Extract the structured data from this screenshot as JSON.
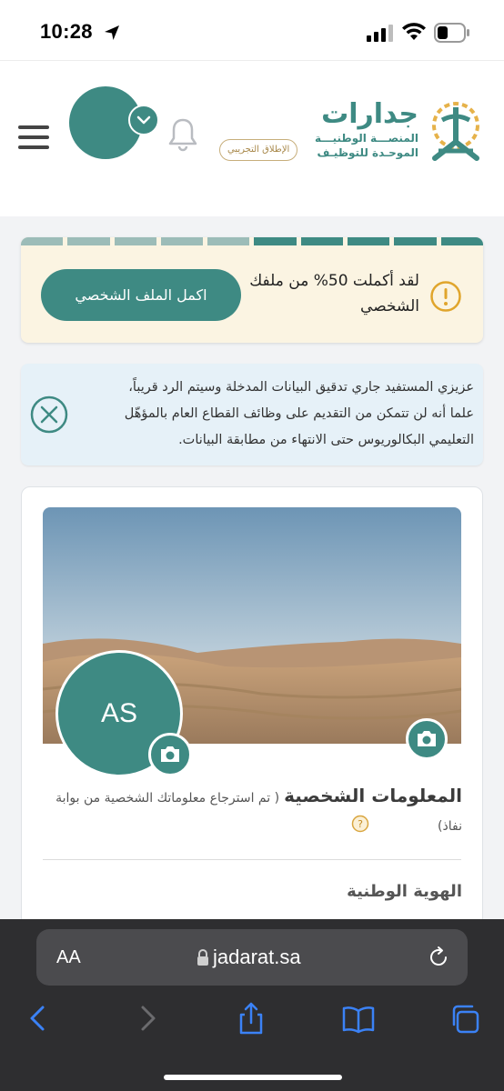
{
  "status_bar": {
    "time": "10:28"
  },
  "header": {
    "logo": {
      "name": "جدارات",
      "subtitle_line1": "المنصـــة الوطنيـــة",
      "subtitle_line2": "الموحـدة للتوظيـف"
    },
    "beta_badge": "الإطلاق التجريبي",
    "icons": {
      "menu": "hamburger-menu-icon",
      "notifications": "bell-icon",
      "account": "chevron-down-icon"
    },
    "accent_color": "#3e8a83"
  },
  "progress": {
    "message": "لقد أكملت 50% من ملفك الشخصي",
    "percent": 50,
    "segments_total": 10,
    "segments_filled": 5,
    "button_label": "اكمل الملف الشخصي",
    "warning_color": "#e0a52c"
  },
  "info_banner": {
    "message": "عزيزي المستفيد جاري تدقيق البيانات المدخلة وسيتم الرد قريباً، علما أنه لن تتمكن من التقديم على وظائف القطاع العام بالمؤهّل التعليمي البكالوريوس حتى الانتهاء من مطابقة البيانات."
  },
  "profile": {
    "initials": "AS",
    "section_title": "المعلومات الشخصية",
    "section_note": "( تم استرجاع معلوماتك الشخصية من بوابة نفاذ)",
    "national_id_label": "الهوية الوطنية"
  },
  "browser": {
    "text_size_label": "AA",
    "url": "jadarat.sa",
    "toolbar_icons": [
      "back-icon",
      "forward-icon",
      "share-icon",
      "bookmarks-icon",
      "tabs-icon"
    ]
  }
}
